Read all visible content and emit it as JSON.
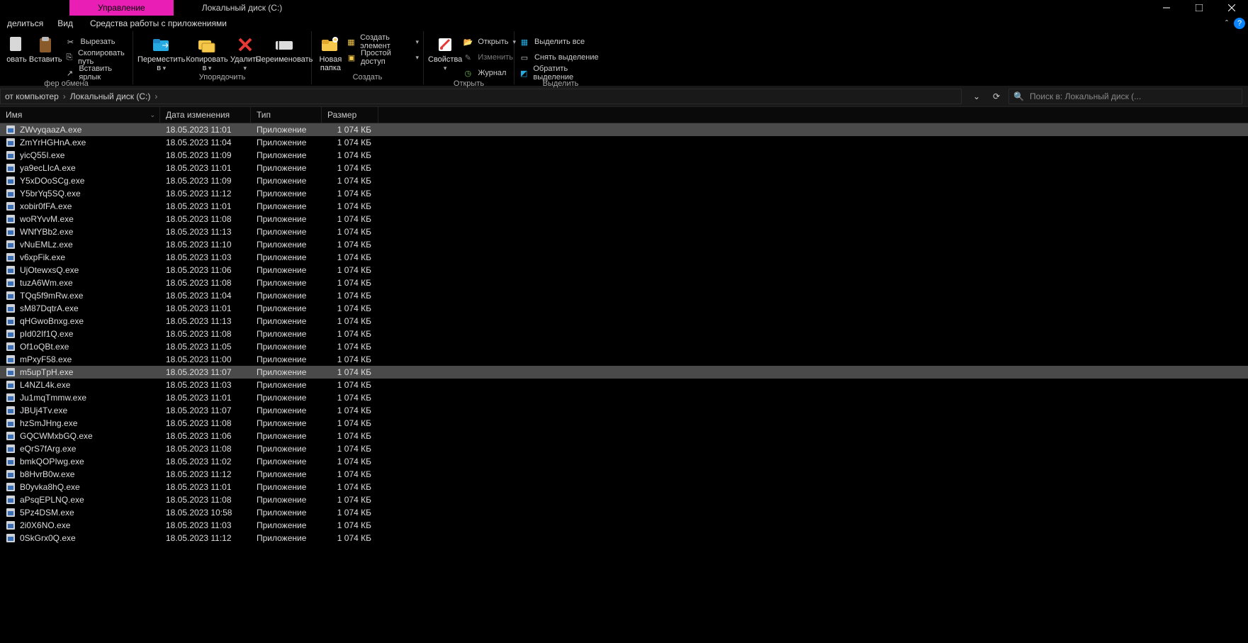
{
  "title": "Локальный диск (С:)",
  "tabs": {
    "manage": "Управление",
    "apptools": "Средства работы с приложениями"
  },
  "subheader": {
    "share": "делиться",
    "view": "Вид"
  },
  "ribbon": {
    "clipboard": {
      "caption": "фер обмена",
      "act": "овать",
      "paste": "Вставить",
      "cut": "Вырезать",
      "copypath": "Скопировать путь",
      "pastelink": "Вставить ярлык"
    },
    "organize": {
      "caption": "Упорядочить",
      "move": "Переместить в",
      "copy": "Копировать в",
      "delete": "Удалить",
      "rename": "Переименовать"
    },
    "create": {
      "caption": "Создать",
      "newfolder": "Новая папка",
      "newitem": "Создать элемент",
      "easyaccess": "Простой доступ"
    },
    "open": {
      "caption": "Открыть",
      "properties": "Свойства",
      "open": "Открыть",
      "edit": "Изменить",
      "history": "Журнал"
    },
    "select": {
      "caption": "Выделить",
      "all": "Выделить все",
      "none": "Снять выделение",
      "invert": "Обратить выделение"
    }
  },
  "breadcrumbs": {
    "computer": "от компьютер",
    "drive": "Локальный диск (С:)"
  },
  "search_placeholder": "Поиск в: Локальный диск (...",
  "columns": {
    "name": "Имя",
    "date": "Дата изменения",
    "type": "Тип",
    "size": "Размер"
  },
  "filetype": "Приложение",
  "filesize": "1 074 КБ",
  "files": [
    {
      "n": "ZWvyqaazA.exe",
      "d": "18.05.2023 11:01",
      "sel": true
    },
    {
      "n": "ZmYrHGHnA.exe",
      "d": "18.05.2023 11:04"
    },
    {
      "n": "yicQ55I.exe",
      "d": "18.05.2023 11:09"
    },
    {
      "n": "ya9ecLIcA.exe",
      "d": "18.05.2023 11:01"
    },
    {
      "n": "Y5xDOoSCg.exe",
      "d": "18.05.2023 11:09"
    },
    {
      "n": "Y5brYq5SQ.exe",
      "d": "18.05.2023 11:12"
    },
    {
      "n": "xobir0fFA.exe",
      "d": "18.05.2023 11:01"
    },
    {
      "n": "woRYvvM.exe",
      "d": "18.05.2023 11:08"
    },
    {
      "n": "WNfYBb2.exe",
      "d": "18.05.2023 11:13"
    },
    {
      "n": "vNuEMLz.exe",
      "d": "18.05.2023 11:10"
    },
    {
      "n": "v6xpFik.exe",
      "d": "18.05.2023 11:03"
    },
    {
      "n": "UjOtewxsQ.exe",
      "d": "18.05.2023 11:06"
    },
    {
      "n": "tuzA6Wm.exe",
      "d": "18.05.2023 11:08"
    },
    {
      "n": "TQq5f9mRw.exe",
      "d": "18.05.2023 11:04"
    },
    {
      "n": "sM87DqtrA.exe",
      "d": "18.05.2023 11:01"
    },
    {
      "n": "qHGwoBnxg.exe",
      "d": "18.05.2023 11:13"
    },
    {
      "n": "pId02If1Q.exe",
      "d": "18.05.2023 11:08"
    },
    {
      "n": "Of1oQBt.exe",
      "d": "18.05.2023 11:05"
    },
    {
      "n": "mPxyF58.exe",
      "d": "18.05.2023 11:00"
    },
    {
      "n": "m5upTpH.exe",
      "d": "18.05.2023 11:07",
      "sel": true
    },
    {
      "n": "L4NZL4k.exe",
      "d": "18.05.2023 11:03"
    },
    {
      "n": "Ju1mqTmmw.exe",
      "d": "18.05.2023 11:01"
    },
    {
      "n": "JBUj4Tv.exe",
      "d": "18.05.2023 11:07"
    },
    {
      "n": "hzSmJHng.exe",
      "d": "18.05.2023 11:08"
    },
    {
      "n": "GQCWMxbGQ.exe",
      "d": "18.05.2023 11:06"
    },
    {
      "n": "eQrS7fArg.exe",
      "d": "18.05.2023 11:08"
    },
    {
      "n": "bmkQOPIwg.exe",
      "d": "18.05.2023 11:02"
    },
    {
      "n": "b8HvrB0w.exe",
      "d": "18.05.2023 11:12"
    },
    {
      "n": "B0yvka8hQ.exe",
      "d": "18.05.2023 11:01"
    },
    {
      "n": "aPsqEPLNQ.exe",
      "d": "18.05.2023 11:08"
    },
    {
      "n": "5Pz4DSM.exe",
      "d": "18.05.2023 10:58"
    },
    {
      "n": "2i0X6NO.exe",
      "d": "18.05.2023 11:03"
    },
    {
      "n": "0SkGrx0Q.exe",
      "d": "18.05.2023 11:12"
    }
  ]
}
